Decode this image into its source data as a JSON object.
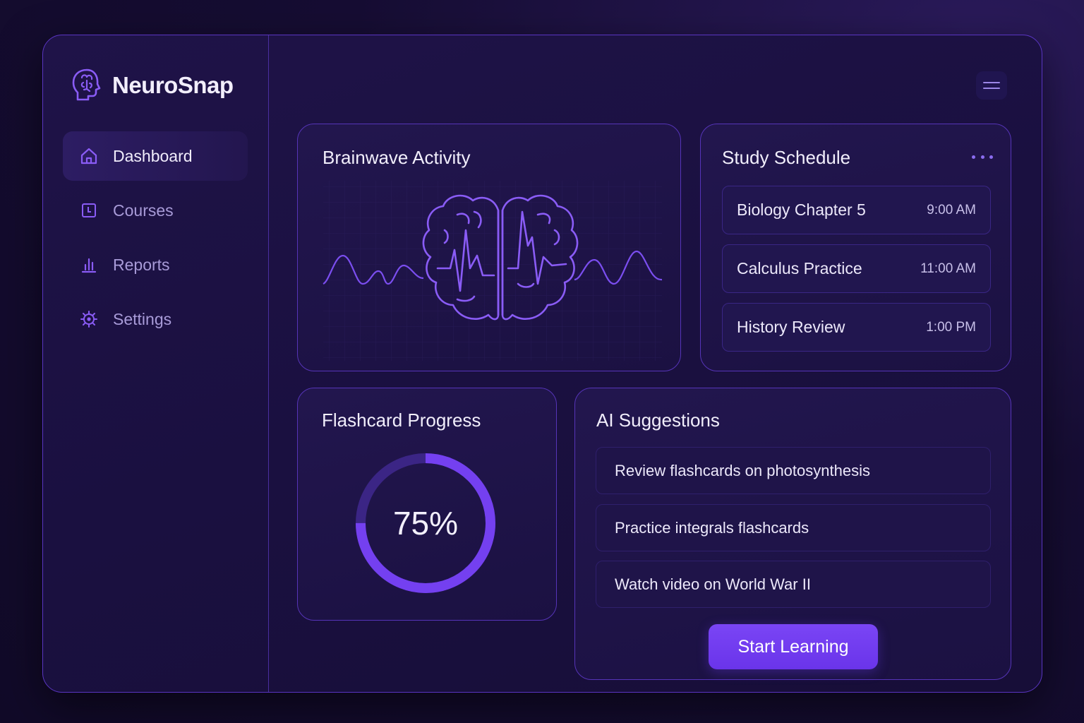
{
  "brand": {
    "name": "NeuroSnap",
    "icon": "brain-head-icon"
  },
  "sidebar": {
    "items": [
      {
        "label": "Dashboard",
        "icon": "home-icon",
        "active": true
      },
      {
        "label": "Courses",
        "icon": "book-icon",
        "active": false
      },
      {
        "label": "Reports",
        "icon": "bar-chart-icon",
        "active": false
      },
      {
        "label": "Settings",
        "icon": "gear-icon",
        "active": false
      }
    ]
  },
  "header": {
    "menu_icon": "menu-icon"
  },
  "brainwave": {
    "title": "Brainwave Activity",
    "illustration": "brain-wave-icon"
  },
  "schedule": {
    "title": "Study Schedule",
    "more_icon": "more-horizontal-icon",
    "items": [
      {
        "name": "Biology Chapter 5",
        "time": "9:00 AM"
      },
      {
        "name": "Calculus Practice",
        "time": "11:00 AM"
      },
      {
        "name": "History Review",
        "time": "1:00 PM"
      }
    ]
  },
  "flashcards": {
    "title": "Flashcard Progress",
    "percent_label": "75%",
    "progress": 0.75
  },
  "ai": {
    "title": "AI Suggestions",
    "items": [
      {
        "text": "Review flashcards on photosynthesis"
      },
      {
        "text": "Practice integrals flashcards"
      },
      {
        "text": "Watch video on World War II"
      }
    ],
    "cta_label": "Start Learning"
  },
  "colors": {
    "accent": "#7a45f5",
    "border": "#5634b8",
    "background": "#160d33",
    "text": "#f1eefb",
    "muted_text": "#a89bd8"
  }
}
